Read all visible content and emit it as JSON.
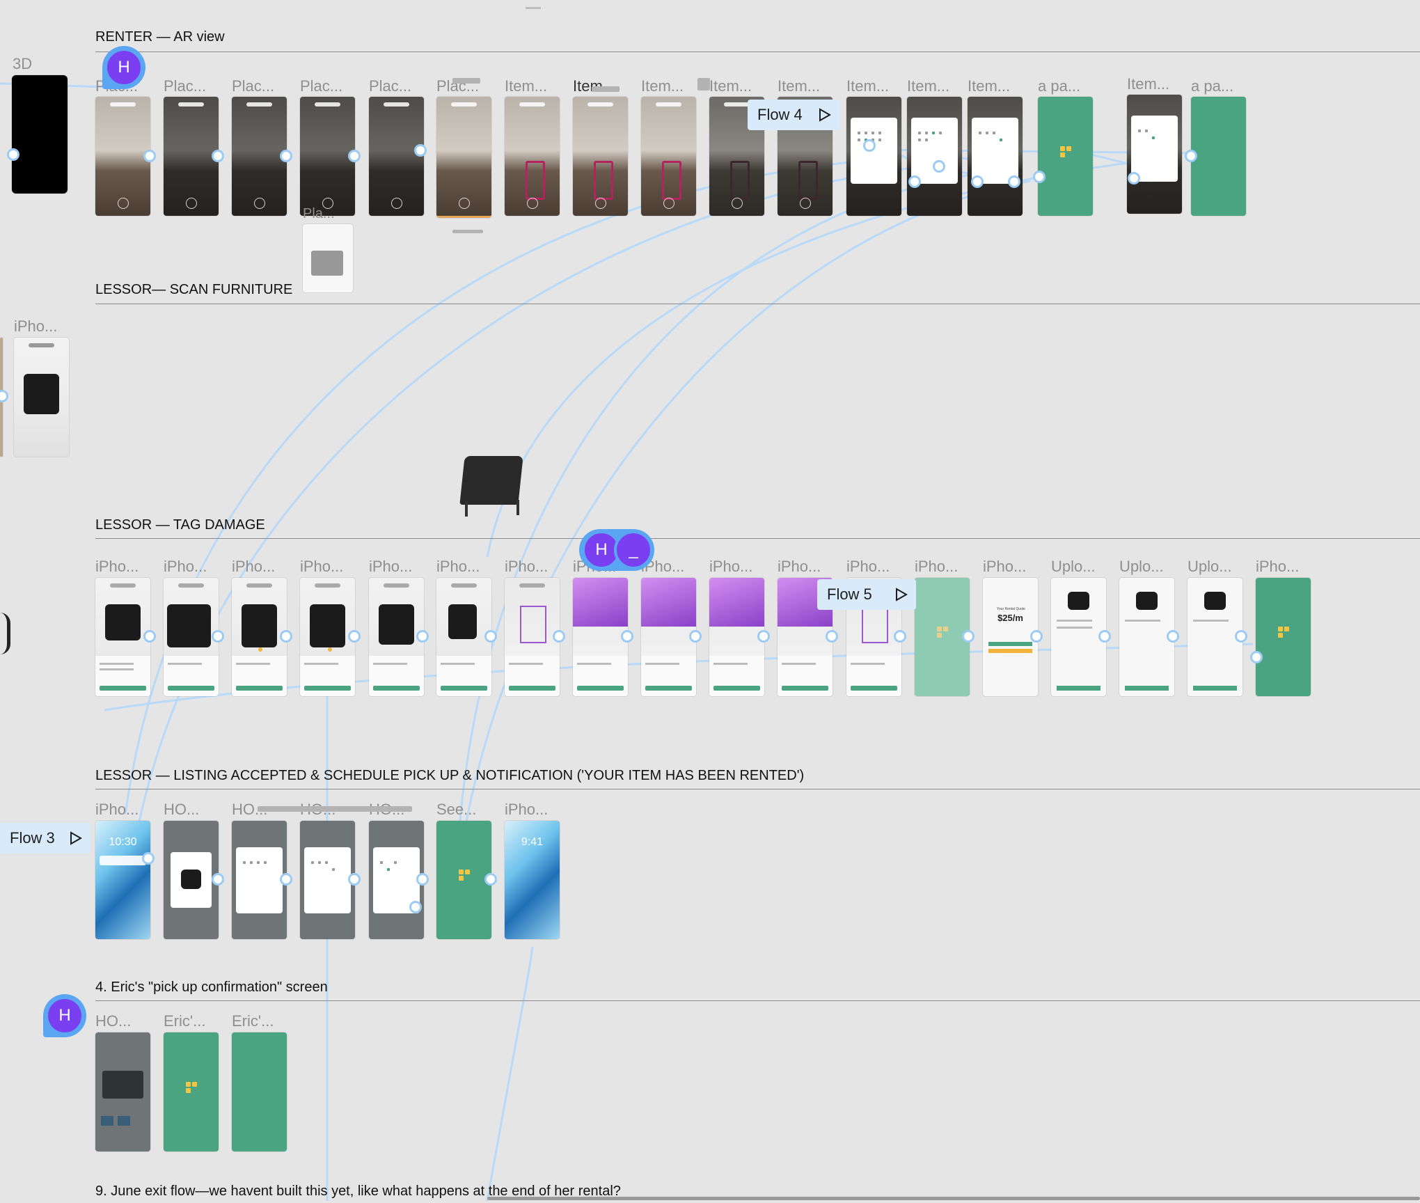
{
  "sections": [
    {
      "id": "renter-ar",
      "title": "RENTER — AR view"
    },
    {
      "id": "lessor-scan",
      "title": "LESSOR— SCAN FURNITURE"
    },
    {
      "id": "lessor-tag",
      "title": "LESSOR — TAG DAMAGE"
    },
    {
      "id": "lessor-listing",
      "title": "LESSOR — LISTING ACCEPTED & SCHEDULE PICK UP & NOTIFICATION ('YOUR ITEM HAS BEEN RENTED')"
    },
    {
      "id": "eric",
      "title": "4. Eric's \"pick up confirmation\" screen"
    },
    {
      "id": "june",
      "title": "9. June exit flow—we havent built this yet, like what happens at the end of her rental?"
    }
  ],
  "row_renter": {
    "left_label": "3D",
    "labels": [
      "Plac...",
      "Plac...",
      "Plac...",
      "Plac...",
      "Plac...",
      "Plac...",
      "Item...",
      "Item...",
      "Item...",
      "Item...",
      "Item...",
      "Item...",
      "Item...",
      "Item...",
      "a pa...",
      "Item...",
      "a pa..."
    ],
    "extra_label": "Pla..."
  },
  "row_scan": {
    "left_label": "iPho..."
  },
  "row_tag": {
    "labels": [
      "iPho...",
      "iPho...",
      "iPho...",
      "iPho...",
      "iPho...",
      "iPho...",
      "iPho...",
      "iPho...",
      "iPho...",
      "iPho...",
      "iPho...",
      "iPho...",
      "iPho...",
      "iPho...",
      "Uplo...",
      "Uplo...",
      "Uplo...",
      "iPho..."
    ],
    "price": "$25/m",
    "quote_title": "Your Rental Quote"
  },
  "row_listing": {
    "labels": [
      "iPho...",
      "HO...",
      "HO...",
      "HO...",
      "HO...",
      "See...",
      "iPho..."
    ],
    "lock_time_1": "10:30",
    "lock_time_2": "9:41"
  },
  "row_eric": {
    "labels": [
      "HO...",
      "Eric'...",
      "Eric'..."
    ]
  },
  "flows": [
    {
      "label": "Flow 4"
    },
    {
      "label": "Flow 5"
    },
    {
      "label": "Flow 3"
    }
  ],
  "avatars": {
    "h1": "H",
    "h2": "H",
    "h2b": "_",
    "h3": "H"
  },
  "colors": {
    "accent_green": "#4aa481",
    "flow_blue": "#d9ebfb",
    "wire": "#b8d9f7",
    "avatar_purple": "#7b3ff2",
    "avatar_ring": "#5aa6f3"
  }
}
